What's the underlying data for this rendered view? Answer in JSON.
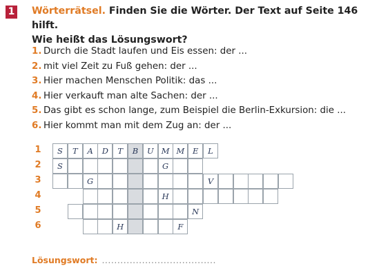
{
  "exercise": {
    "number": "1",
    "title_orange": "Wörterrätsel.",
    "title_rest": "Finden Sie die Wörter. Der Text auf Seite 146 hilft.",
    "title_line2": "Wie heißt das Lösungswort?"
  },
  "clues": [
    {
      "num": "1.",
      "text": "Durch die Stadt laufen und Eis essen: der ..."
    },
    {
      "num": "2.",
      "text": "mit viel Zeit zu Fuß gehen: der ..."
    },
    {
      "num": "3.",
      "text": "Hier machen Menschen Politik: das ..."
    },
    {
      "num": "4.",
      "text": "Hier verkauft man alte Sachen: der ..."
    },
    {
      "num": "5.",
      "text": "Das gibt es schon lange, zum Beispiel die Berlin-Exkursion: die ..."
    },
    {
      "num": "6.",
      "text": "Hier kommt man mit dem Zug an: der ..."
    }
  ],
  "grid": {
    "solution_column": 5,
    "rows": [
      {
        "num": "1",
        "start": 0,
        "cells": [
          "S",
          "T",
          "A",
          "D",
          "T",
          "B",
          "U",
          "M",
          "M",
          "E",
          "L"
        ]
      },
      {
        "num": "2",
        "start": 0,
        "cells": [
          "S",
          "",
          "",
          "",
          "",
          "",
          "",
          "G",
          "",
          ""
        ]
      },
      {
        "num": "3",
        "start": 0,
        "cells": [
          "",
          "",
          "G",
          "",
          "",
          "",
          "",
          "",
          "",
          "",
          "V",
          "",
          "",
          "",
          "",
          ""
        ]
      },
      {
        "num": "4",
        "start": 2,
        "cells": [
          "",
          "",
          "",
          "",
          "",
          "H",
          "",
          "",
          "",
          "",
          "",
          "",
          ""
        ]
      },
      {
        "num": "5",
        "start": 1,
        "cells": [
          "",
          "",
          "",
          "",
          "",
          "",
          "",
          "",
          "N"
        ]
      },
      {
        "num": "6",
        "start": 2,
        "cells": [
          "",
          "",
          "H",
          "",
          "",
          "",
          "F"
        ]
      }
    ]
  },
  "answer": {
    "label": "Lösungswort:",
    "blank": "....................................."
  }
}
